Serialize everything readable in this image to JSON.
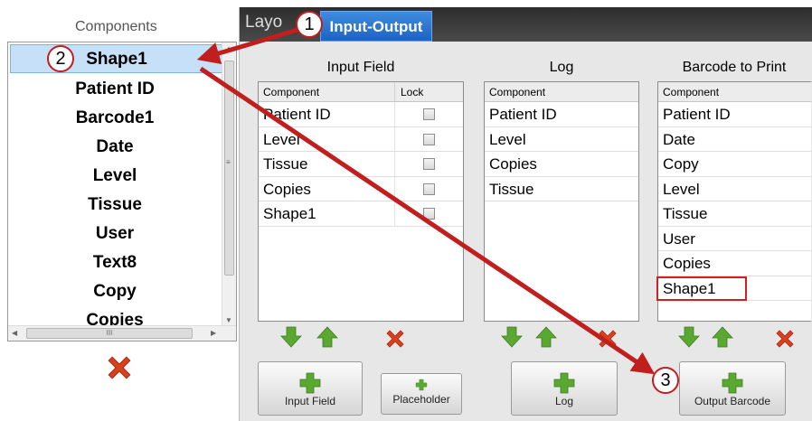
{
  "components_panel": {
    "title": "Components",
    "items": [
      "Shape1",
      "Patient ID",
      "Barcode1",
      "Date",
      "Level",
      "Tissue",
      "User",
      "Text8",
      "Copy",
      "Copies"
    ],
    "selected": "Shape1",
    "hscroll_label": "III",
    "delete_icon": "red-x-icon"
  },
  "tabs": {
    "layout_label": "Layo",
    "io_label": "Input-Output"
  },
  "input_field": {
    "title": "Input Field",
    "col_component": "Component",
    "col_lock": "Lock",
    "rows": [
      "Patient ID",
      "Level",
      "Tissue",
      "Copies",
      "Shape1"
    ],
    "button_label": "Input Field"
  },
  "log": {
    "title": "Log",
    "col_component": "Component",
    "rows": [
      "Patient ID",
      "Level",
      "Copies",
      "Tissue"
    ],
    "button_label": "Log"
  },
  "barcode": {
    "title": "Barcode to Print",
    "col_component": "Component",
    "rows": [
      "Patient ID",
      "Date",
      "Copy",
      "Level",
      "Tissue",
      "User",
      "Copies",
      "Shape1"
    ],
    "highlighted": "Shape1",
    "button_label": "Output Barcode"
  },
  "placeholder_button": {
    "label": "Placeholder"
  },
  "callouts": [
    "1",
    "2",
    "3"
  ],
  "colors": {
    "accent_tab": "#2a74d4",
    "arrow_green": "#5aa832",
    "delete_red": "#d8401e",
    "callout_red": "#c11e1e"
  }
}
